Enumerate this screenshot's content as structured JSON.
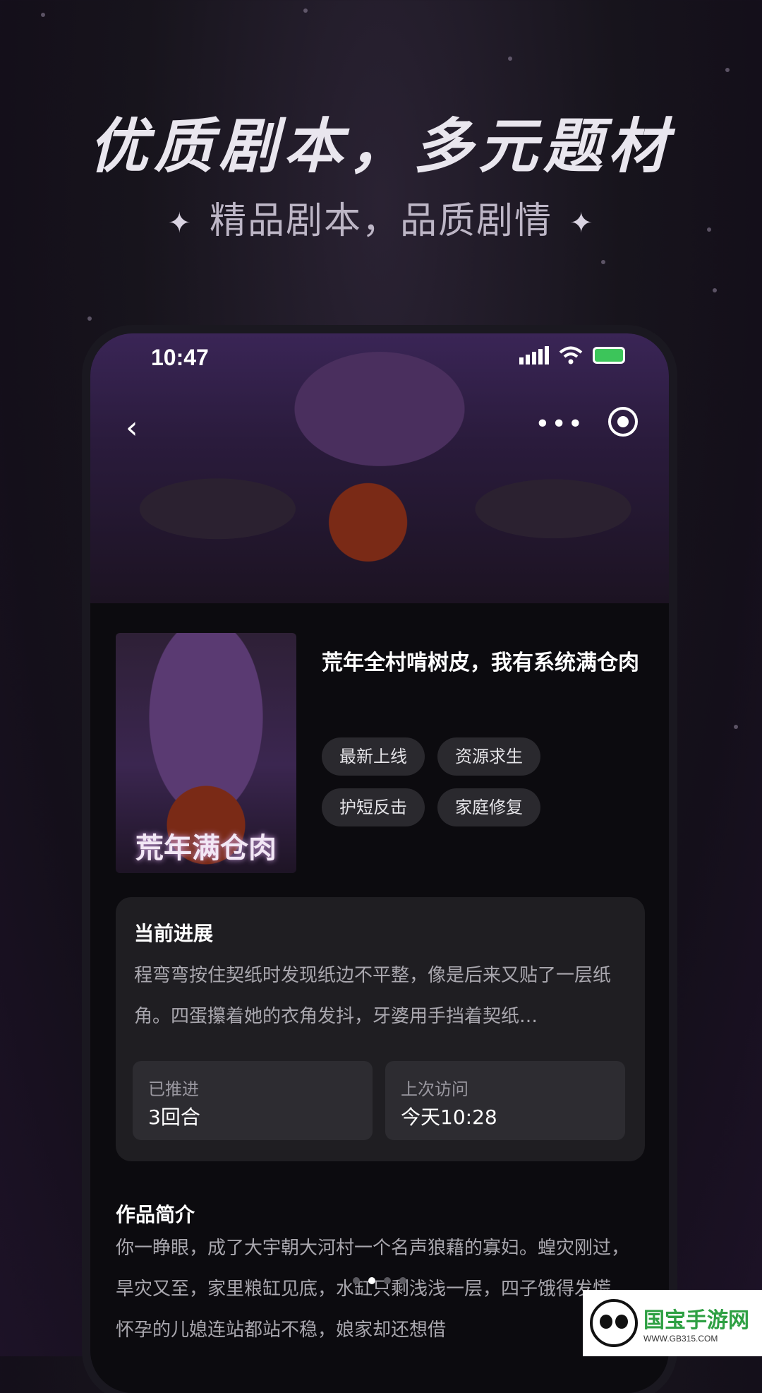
{
  "promo": {
    "headline": "优质剧本，多元题材",
    "subline": "精品剧本，品质剧情",
    "sparkle": "✦"
  },
  "status_bar": {
    "time": "10:47"
  },
  "nav": {
    "back_glyph": "‹",
    "more_glyph": "•••"
  },
  "book": {
    "cover_text": "荒年满仓肉",
    "title": "荒年全村啃树皮，我有系统满仓肉",
    "tags": [
      "最新上线",
      "资源求生",
      "护短反击",
      "家庭修复"
    ]
  },
  "progress": {
    "title": "当前进展",
    "text": "程弯弯按住契纸时发现纸边不平整，像是后来又贴了一层纸角。四蛋攥着她的衣角发抖，牙婆用手挡着契纸…",
    "advanced_label": "已推进",
    "advanced_value": "3回合",
    "last_visit_label": "上次访问",
    "last_visit_value": "今天10:28"
  },
  "intro": {
    "title": "作品简介",
    "text": "你一睁眼，成了大宇朝大河村一个名声狼藉的寡妇。蝗灾刚过，旱灾又至，家里粮缸见底，水缸只剩浅浅一层，四子饿得发慌，怀孕的儿媳连站都站不稳，娘家却还想借"
  },
  "carousel": {
    "active_index": 1,
    "count": 4
  },
  "watermark": {
    "main": "国宝手游网",
    "sub": "WWW.GB315.COM"
  }
}
